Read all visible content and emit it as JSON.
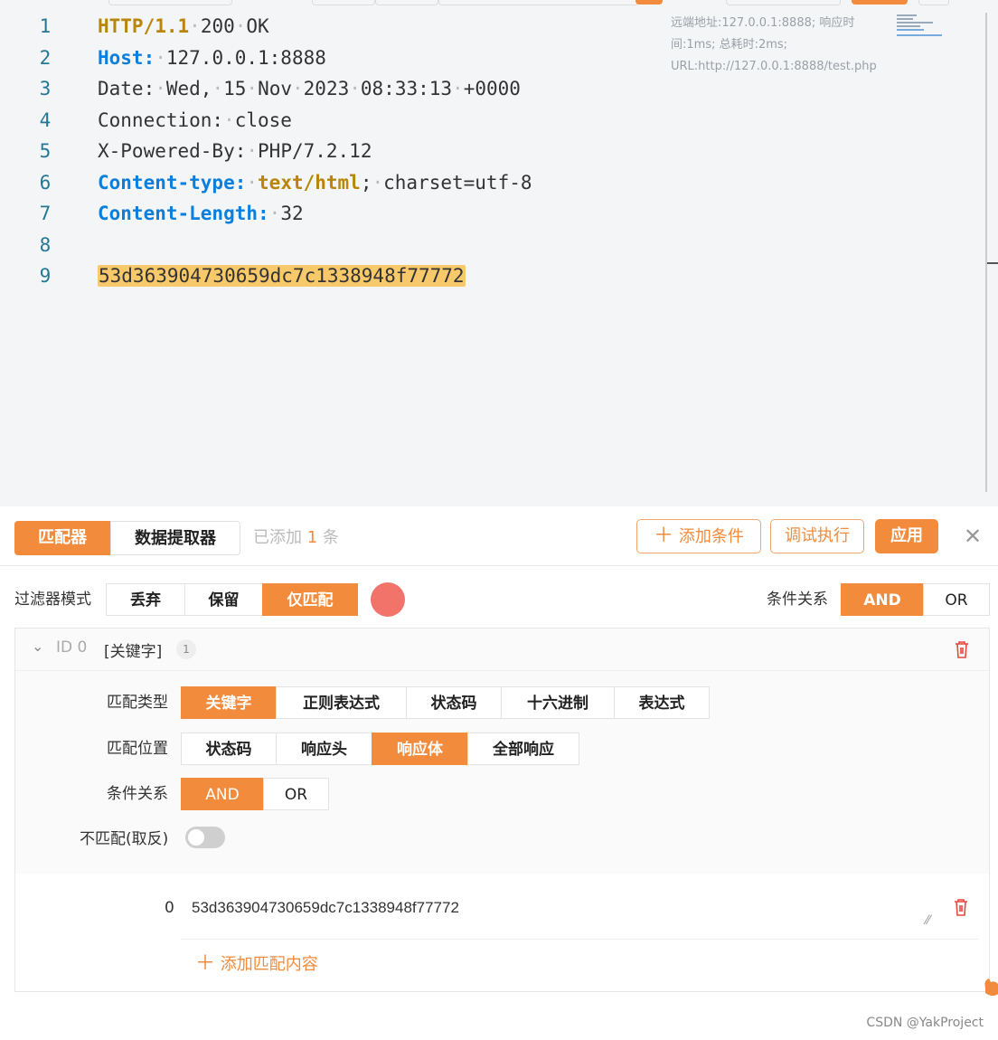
{
  "editor": {
    "lines": [
      {
        "n": "1",
        "parts": [
          {
            "t": "HTTP/1.1",
            "c": "k-gold-b"
          },
          {
            "t": "·",
            "c": "dot"
          },
          {
            "t": "200",
            "c": ""
          },
          {
            "t": "·",
            "c": "dot"
          },
          {
            "t": "OK",
            "c": ""
          }
        ]
      },
      {
        "n": "2",
        "parts": [
          {
            "t": "Host:",
            "c": "k-blue"
          },
          {
            "t": "·",
            "c": "dot"
          },
          {
            "t": "127.0.0.1:8888",
            "c": ""
          }
        ]
      },
      {
        "n": "3",
        "parts": [
          {
            "t": "Date:",
            "c": ""
          },
          {
            "t": "·",
            "c": "dot"
          },
          {
            "t": "Wed,",
            "c": ""
          },
          {
            "t": "·",
            "c": "dot"
          },
          {
            "t": "15",
            "c": ""
          },
          {
            "t": "·",
            "c": "dot"
          },
          {
            "t": "Nov",
            "c": ""
          },
          {
            "t": "·",
            "c": "dot"
          },
          {
            "t": "2023",
            "c": ""
          },
          {
            "t": "·",
            "c": "dot"
          },
          {
            "t": "08:33:13",
            "c": ""
          },
          {
            "t": "·",
            "c": "dot"
          },
          {
            "t": "+0000",
            "c": ""
          }
        ]
      },
      {
        "n": "4",
        "parts": [
          {
            "t": "Connection:",
            "c": ""
          },
          {
            "t": "·",
            "c": "dot"
          },
          {
            "t": "close",
            "c": ""
          }
        ]
      },
      {
        "n": "5",
        "parts": [
          {
            "t": "X-Powered-By:",
            "c": ""
          },
          {
            "t": "·",
            "c": "dot"
          },
          {
            "t": "PHP/7.2.12",
            "c": ""
          }
        ]
      },
      {
        "n": "6",
        "parts": [
          {
            "t": "Content-type:",
            "c": "k-blue"
          },
          {
            "t": "·",
            "c": "dot"
          },
          {
            "t": "text/html",
            "c": "k-gold-b"
          },
          {
            "t": ";",
            "c": ""
          },
          {
            "t": "·",
            "c": "dot"
          },
          {
            "t": "charset=utf-8",
            "c": ""
          }
        ]
      },
      {
        "n": "7",
        "parts": [
          {
            "t": "Content-Length:",
            "c": "k-blue"
          },
          {
            "t": "·",
            "c": "dot"
          },
          {
            "t": "32",
            "c": ""
          }
        ]
      },
      {
        "n": "8",
        "parts": []
      },
      {
        "n": "9",
        "parts": [
          {
            "t": "53d363904730659dc7c1338948f77772",
            "c": "hl"
          }
        ]
      }
    ],
    "meta": "远端地址:127.0.0.1:8888; 响应时间:1ms; 总耗时:2ms; URL:http://127.0.0.1:8888/test.php"
  },
  "panel": {
    "tab_matcher": "匹配器",
    "tab_extractor": "数据提取器",
    "added_prefix": "已添加",
    "added_count": "1",
    "added_suffix": "条",
    "add_condition": "添加条件",
    "debug_run": "调试执行",
    "apply": "应用",
    "filter_mode_label": "过滤器模式",
    "filter_modes": [
      "丢弃",
      "保留",
      "仅匹配"
    ],
    "cond_rel_label": "条件关系",
    "cond_rel_options": [
      "AND",
      "OR"
    ]
  },
  "card": {
    "id": "ID 0",
    "kind": "[关键字]",
    "count": "1",
    "match_type_label": "匹配类型",
    "match_types": [
      "关键字",
      "正则表达式",
      "状态码",
      "十六进制",
      "表达式"
    ],
    "match_pos_label": "匹配位置",
    "match_positions": [
      "状态码",
      "响应头",
      "响应体",
      "全部响应"
    ],
    "cond_rel_label": "条件关系",
    "cond_rel_options": [
      "AND",
      "OR"
    ],
    "negate_label": "不匹配(取反)",
    "entry_index": "0",
    "entry_value": "53d363904730659dc7c1338948f77772",
    "add_match_content": "添加匹配内容"
  },
  "footer": "CSDN @YakProject",
  "colors": {
    "accent": "#f28b3c",
    "record_dot": "#f2736a",
    "highlight": "#f8c96b",
    "keyword_blue": "#0a7fdd",
    "keyword_gold": "#b8860b"
  }
}
